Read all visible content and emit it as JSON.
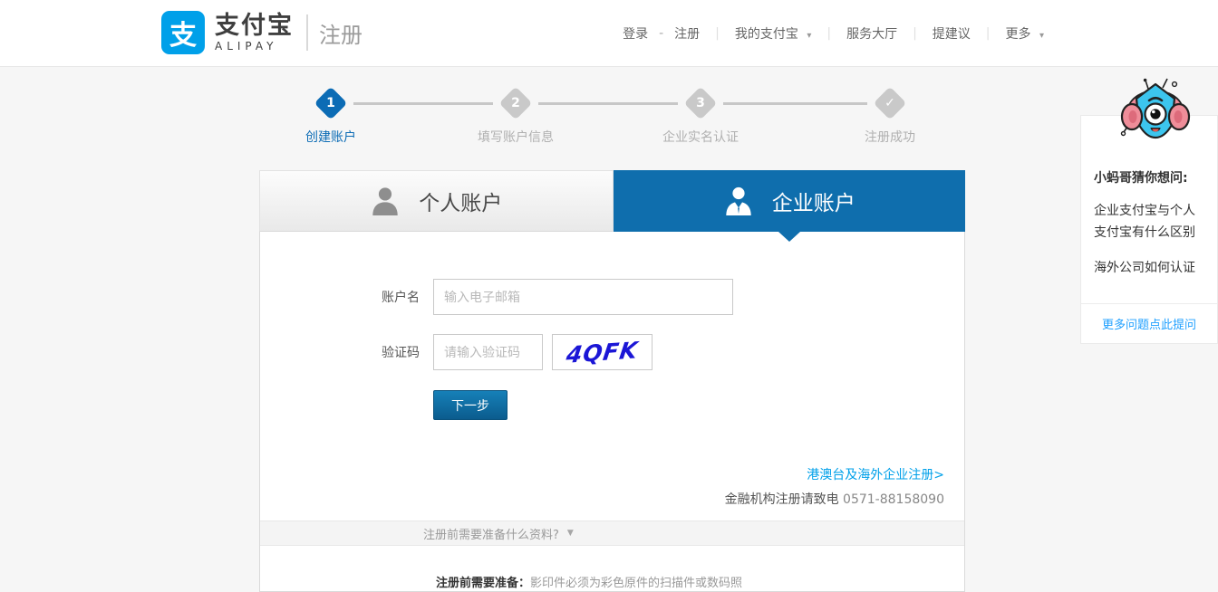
{
  "header": {
    "logo": {
      "icon_char": "支",
      "brand_cn": "支付宝",
      "brand_en": "ALIPAY",
      "page_label": "注册"
    },
    "nav": {
      "login": "登录",
      "dash": "-",
      "register": "注册",
      "separator": "|",
      "my_alipay": "我的支付宝",
      "service_hall": "服务大厅",
      "suggestion": "提建议",
      "more": "更多"
    }
  },
  "icons": {
    "dropdown_arrow": "▾",
    "accordion_arrow": "▼"
  },
  "steps": [
    {
      "num": "1",
      "label": "创建账户",
      "state": "active"
    },
    {
      "num": "2",
      "label": "填写账户信息",
      "state": "pending"
    },
    {
      "num": "3",
      "label": "企业实名认证",
      "state": "pending"
    },
    {
      "num": "✓",
      "label": "注册成功",
      "state": "pending"
    }
  ],
  "tabs": {
    "personal": "个人账户",
    "enterprise": "企业账户"
  },
  "form": {
    "account_label": "账户名",
    "account_placeholder": "输入电子邮箱",
    "account_value": "",
    "captcha_label": "验证码",
    "captcha_placeholder": "请输入验证码",
    "captcha_value": "",
    "captcha_image_text": "4QFK",
    "next_button": "下一步",
    "overseas_link": "港澳台及海外企业注册>",
    "finance_note": "金融机构注册请致电",
    "finance_phone": "0571-88158090",
    "accordion_title": "注册前需要准备什么资料?",
    "prepare_label": "注册前需要准备：",
    "prepare_text": "影印件必须为彩色原件的扫描件或数码照"
  },
  "sidebar": {
    "title": "小蚂哥猜你想问:",
    "questions": [
      {
        "text": "企业支付宝与个人支付宝有什么区别"
      },
      {
        "text": "海外公司如何认证"
      }
    ],
    "more_link": "更多问题点此提问"
  },
  "colors": {
    "brand_blue": "#00a0e9",
    "tab_blue": "#0f6ead",
    "step_active_blue": "#0c6cb5",
    "link_blue": "#1e9fff",
    "captcha_text_blue": "#1b16d6"
  }
}
